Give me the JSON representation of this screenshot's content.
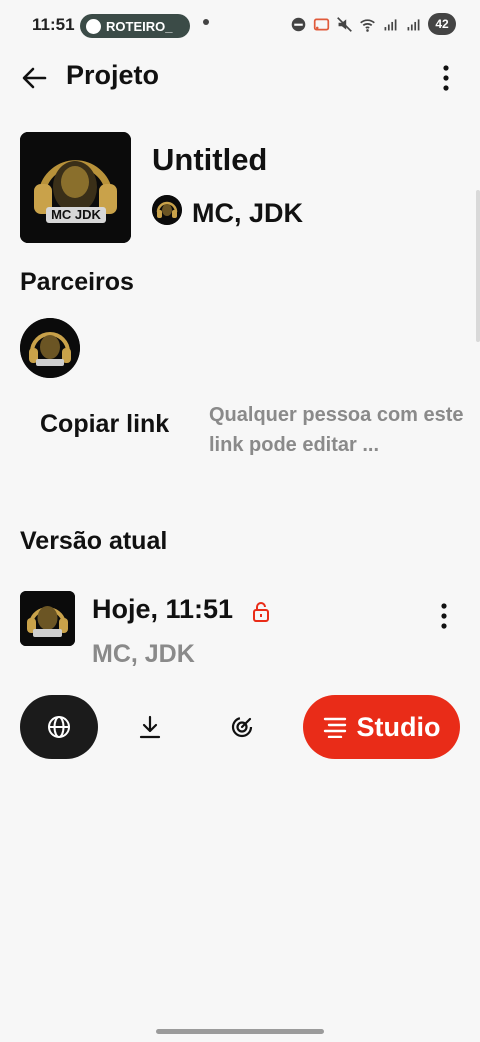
{
  "status_bar": {
    "time": "11:51",
    "notification_label": "ROTEIRO_",
    "battery": "42"
  },
  "header": {
    "title": "Projeto",
    "back_icon": "arrow-left-icon",
    "more_icon": "more-vertical-icon"
  },
  "project": {
    "title": "Untitled",
    "owner": "MC, JDK",
    "cover_logo_text": "MC JDK"
  },
  "partners": {
    "heading": "Parceiros"
  },
  "share": {
    "copy_link_label": "Copiar link",
    "hint": "Qualquer pessoa com este link pode editar ..."
  },
  "current_version": {
    "heading": "Versão atual",
    "date": "Hoje, 11:51",
    "author": "MC, JDK",
    "lock_icon": "lock-icon"
  },
  "actions": {
    "globe_icon": "globe-icon",
    "download_icon": "download-icon",
    "mastering_icon": "mastering-icon",
    "studio_label": "Studio",
    "studio_icon": "studio-lines-icon"
  },
  "colors": {
    "accent": "#e92c18",
    "dark_button": "#1b1b1b",
    "muted_text": "#8a8a8a",
    "background": "#f7f7f7"
  }
}
